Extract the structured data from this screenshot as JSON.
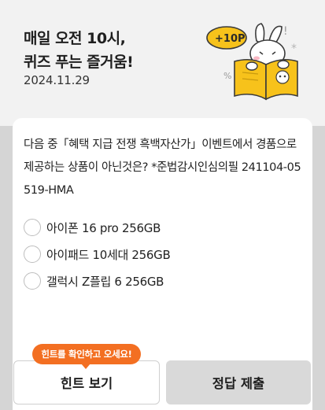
{
  "header": {
    "title_line1": "매일 오전 10시,",
    "title_line2": "퀴즈 푸는 즐거움!",
    "date": "2024.11.29",
    "illustration_badge": "+10P"
  },
  "quiz": {
    "question": "다음 중「혜택 지급 전쟁 흑백자산가」이벤트에서 경품으로 제공하는 상품이 아닌것은? *준법감시인심의필 241104-05519-HMA",
    "options": [
      "아이폰 16 pro 256GB",
      "아이패드 10세대 256GB",
      "갤럭시 Z플립 6 256GB"
    ]
  },
  "footer": {
    "hint_tooltip": "힌트를 확인하고 오세요!",
    "hint_button": "힌트 보기",
    "submit_button": "정답 제출"
  },
  "colors": {
    "accent": "#f36f22",
    "badge_yellow": "#f7c21b"
  }
}
